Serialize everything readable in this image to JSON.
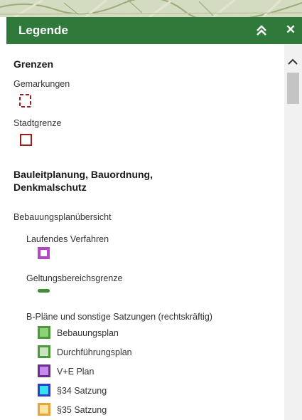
{
  "header": {
    "title": "Legende"
  },
  "sections": {
    "grenzen": {
      "title": "Grenzen",
      "items": [
        "Gemarkungen",
        "Stadtgrenze"
      ]
    },
    "bauleit": {
      "title_line1": "Bauleitplanung, Bauordnung,",
      "title_line2": "Denkmalschutz",
      "layer": "Bebauungsplanübersicht",
      "sub1": "Laufendes Verfahren",
      "sub2": "Geltungsbereichsgrenze",
      "sub3": "B-Pläne und sonstige Satzungen (rechtskräftig)",
      "entries": [
        "Bebauungsplan",
        "Durchführungsplan",
        "V+E Plan",
        "§34 Satzung",
        "§35 Satzung"
      ]
    }
  },
  "colors": {
    "header_bg": "#2f7a3b",
    "boundary_red": "#9b1c1c",
    "laufendes": "#b347c4",
    "geltung": "#3f8f3a",
    "bebauungsplan": [
      "#4a9a3a",
      "#8fd07a"
    ],
    "durchfuehrungsplan": [
      "#4a9a3a",
      "#c9e2bf"
    ],
    "ve_plan": [
      "#6a2f86",
      "#c58bf0"
    ],
    "satzung34": [
      "#2c3ec9",
      "#35e0f5"
    ],
    "satzung35": [
      "#e8a33a",
      "#fbe3a0"
    ]
  },
  "icons": [
    "chevron-up-double-icon",
    "close-icon",
    "scroll-up-icon"
  ]
}
